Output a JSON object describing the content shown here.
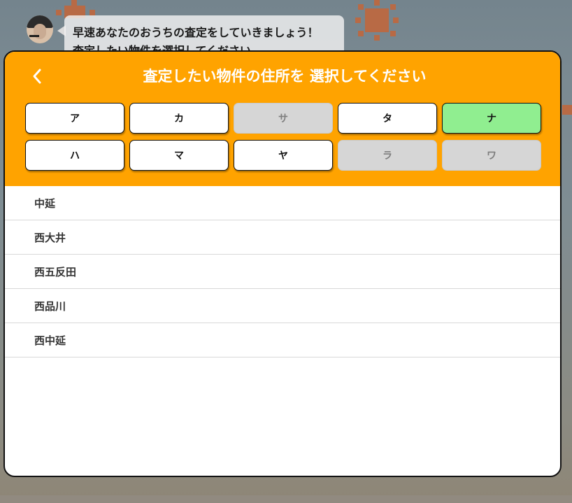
{
  "chat": {
    "message": "早速あなたのおうちの査定をしていきましょう！\n査定したい物件を選択してください"
  },
  "modal": {
    "title": "査定したい物件の住所を 選択してください",
    "back_icon": "chevron-left-icon",
    "kana_buttons": [
      {
        "label": "ア",
        "state": "enabled"
      },
      {
        "label": "カ",
        "state": "enabled"
      },
      {
        "label": "サ",
        "state": "disabled"
      },
      {
        "label": "タ",
        "state": "enabled"
      },
      {
        "label": "ナ",
        "state": "selected"
      },
      {
        "label": "ハ",
        "state": "enabled"
      },
      {
        "label": "マ",
        "state": "enabled"
      },
      {
        "label": "ヤ",
        "state": "enabled"
      },
      {
        "label": "ラ",
        "state": "disabled"
      },
      {
        "label": "ワ",
        "state": "disabled"
      }
    ],
    "addresses": [
      "中延",
      "西大井",
      "西五反田",
      "西品川",
      "西中延"
    ]
  },
  "colors": {
    "header": "#ffa300",
    "selected": "#90ee90",
    "disabled": "#d6d6d6"
  }
}
